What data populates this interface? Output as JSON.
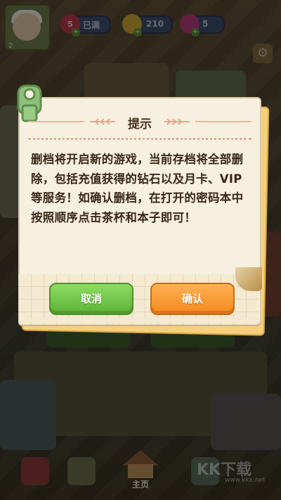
{
  "hud": {
    "level": "2",
    "hearts_badge": "5",
    "hearts_value": "已满",
    "coins_value": "210",
    "gems_value": "5"
  },
  "dialog": {
    "title": "提示",
    "message": "删档将开启新的游戏，当前存档将全部删除，包括充值获得的钻石以及月卡、VIP等服务！如确认删档，在打开的密码本中按照顺序点击茶杯和本子即可！",
    "cancel_label": "取消",
    "confirm_label": "确认"
  },
  "nav": {
    "home_label": "主页"
  },
  "watermark": {
    "text": "KK下载",
    "url": "www.kkx.net"
  },
  "colors": {
    "paper": "#f7f0e0",
    "cancel_button": "#6cc244",
    "confirm_button": "#f89a32",
    "title_text": "#4a3020",
    "body_text": "#3a2818"
  }
}
